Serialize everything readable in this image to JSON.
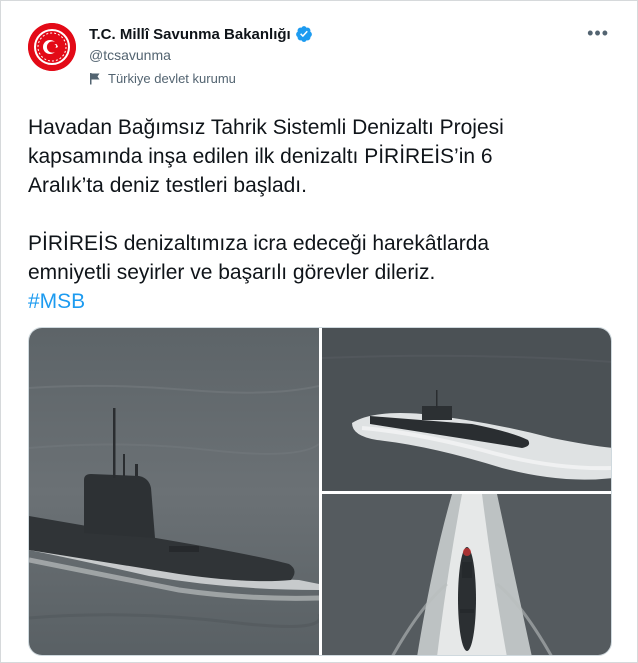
{
  "tweet": {
    "author_name": "T.C. Millî Savunma Bakanlığı",
    "handle": "@tcsavunma",
    "label": "Türkiye devlet kurumu",
    "more_icon": "more-horizontal-icon",
    "paragraph1_line1": "Havadan Bağımsız Tahrik Sistemli Denizaltı Projesi",
    "paragraph1_line2": "kapsamında inşa edilen ilk denizaltı PİRİREİS’in 6",
    "paragraph1_line3": "Aralık’ta deniz testleri başladı.",
    "paragraph2_line1": "PİRİREİS denizaltımıza icra edeceği harekâtlarda",
    "paragraph2_line2": "emniyetli seyirler ve başarılı görevler dileriz.",
    "hashtag": "#MSB"
  },
  "colors": {
    "brand_red": "#e30a17",
    "verified_blue": "#1d9bf0",
    "hashtag_blue": "#1d9bf0",
    "secondary_text": "#536471"
  }
}
